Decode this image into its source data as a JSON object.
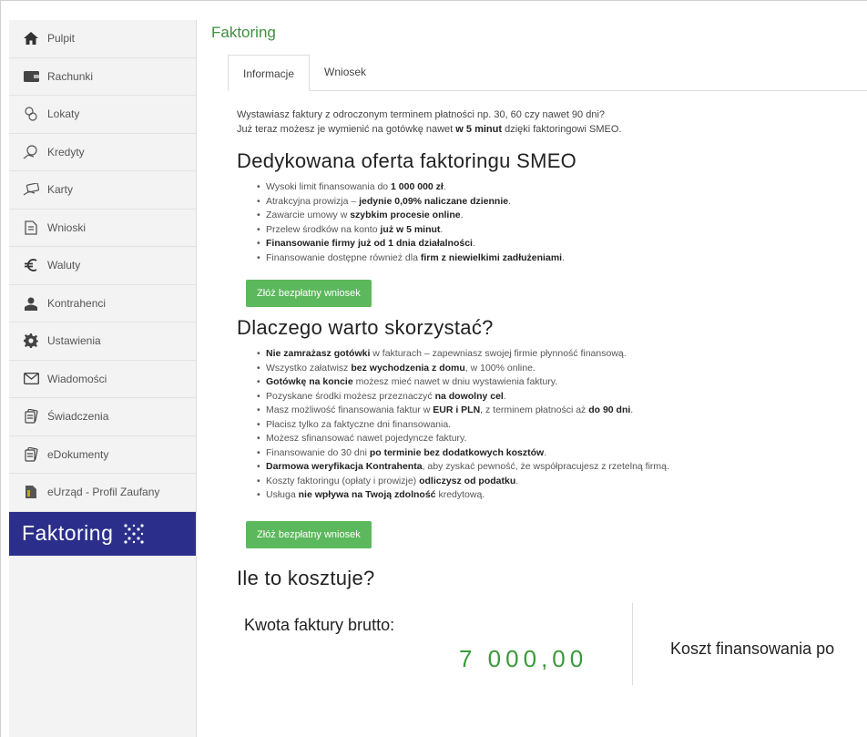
{
  "sidebar": {
    "items": [
      {
        "label": "Pulpit",
        "icon": "home-icon"
      },
      {
        "label": "Rachunki",
        "icon": "wallet-icon"
      },
      {
        "label": "Lokaty",
        "icon": "coins-icon"
      },
      {
        "label": "Kredyty",
        "icon": "loan-icon"
      },
      {
        "label": "Karty",
        "icon": "card-hand-icon"
      },
      {
        "label": "Wnioski",
        "icon": "document-icon"
      },
      {
        "label": "Waluty",
        "icon": "euro-icon"
      },
      {
        "label": "Kontrahenci",
        "icon": "contractor-icon"
      },
      {
        "label": "Ustawienia",
        "icon": "gear-icon"
      },
      {
        "label": "Wiadomości",
        "icon": "envelope-icon"
      },
      {
        "label": "Świadczenia",
        "icon": "document-stack-icon"
      },
      {
        "label": "eDokumenty",
        "icon": "document-stack-icon"
      },
      {
        "label": "eUrząd - Profil Zaufany",
        "icon": "profile-doc-icon"
      }
    ],
    "faktoring_label": "Faktoring",
    "active_color": "#2b2f8b"
  },
  "main": {
    "title": "Faktoring",
    "tabs": [
      {
        "label": "Informacje",
        "active": true
      },
      {
        "label": "Wniosek",
        "active": false
      }
    ],
    "intro": {
      "line1": "Wystawiasz faktury z odroczonym terminem płatności np. 30, 60 czy nawet 90 dni?",
      "line2_a": "Już teraz możesz je wymienić na gotówkę nawet ",
      "line2_b": "w 5 minut",
      "line2_c": " dzięki faktoringowi SMEO."
    },
    "section1": {
      "heading": "Dedykowana oferta faktoringu SMEO",
      "items": [
        [
          {
            "t": "Wysoki limit finansowania do "
          },
          {
            "t": "1 000 000 zł",
            "b": true
          },
          {
            "t": "."
          }
        ],
        [
          {
            "t": "Atrakcyjna prowizja – "
          },
          {
            "t": "jedynie 0,09% naliczane dziennie",
            "b": true
          },
          {
            "t": "."
          }
        ],
        [
          {
            "t": "Zawarcie umowy w "
          },
          {
            "t": "szybkim procesie online",
            "b": true
          },
          {
            "t": "."
          }
        ],
        [
          {
            "t": "Przelew środków na konto "
          },
          {
            "t": "już w 5 minut",
            "b": true
          },
          {
            "t": "."
          }
        ],
        [
          {
            "t": "Finansowanie firmy już od 1 dnia działalności",
            "b": true
          },
          {
            "t": "."
          }
        ],
        [
          {
            "t": "Finansowanie dostępne również dla "
          },
          {
            "t": "firm z niewielkimi zadłużeniami",
            "b": true
          },
          {
            "t": "."
          }
        ]
      ],
      "cta": "Złóż bezpłatny wniosek"
    },
    "section2": {
      "heading": "Dlaczego warto skorzystać?",
      "items": [
        [
          {
            "t": "Nie zamrażasz gotówki",
            "b": true
          },
          {
            "t": " w fakturach – zapewniasz swojej firmie płynność finansową."
          }
        ],
        [
          {
            "t": "Wszystko załatwisz "
          },
          {
            "t": "bez wychodzenia z domu",
            "b": true
          },
          {
            "t": ", w 100% online."
          }
        ],
        [
          {
            "t": "Gotówkę na koncie",
            "b": true
          },
          {
            "t": " możesz mieć nawet w dniu wystawienia faktury."
          }
        ],
        [
          {
            "t": "Pozyskane środki możesz przeznaczyć "
          },
          {
            "t": "na dowolny cel",
            "b": true
          },
          {
            "t": "."
          }
        ],
        [
          {
            "t": "Masz możliwość finansowania faktur w "
          },
          {
            "t": "EUR i PLN",
            "b": true
          },
          {
            "t": ", z terminem płatności aż "
          },
          {
            "t": "do 90 dni",
            "b": true
          },
          {
            "t": "."
          }
        ],
        [
          {
            "t": "Płacisz tylko za faktyczne dni finansowania."
          }
        ],
        [
          {
            "t": "Możesz sfinansować nawet pojedyncze faktury."
          }
        ],
        [
          {
            "t": "Finansowanie do 30 dni "
          },
          {
            "t": "po terminie bez dodatkowych kosztów",
            "b": true
          },
          {
            "t": "."
          }
        ],
        [
          {
            "t": "Darmowa weryfikacja Kontrahenta",
            "b": true
          },
          {
            "t": ", aby zyskać pewność, że współpracujesz z rzetelną firmą."
          }
        ],
        [
          {
            "t": "Koszty faktoringu (opłaty i prowizje) "
          },
          {
            "t": "odliczysz od podatku",
            "b": true
          },
          {
            "t": "."
          }
        ],
        [
          {
            "t": "Usługa "
          },
          {
            "t": "nie wpływa na Twoją zdolność",
            "b": true
          },
          {
            "t": " kredytową."
          }
        ]
      ],
      "cta": "Złóż bezpłatny wniosek"
    },
    "section3": {
      "heading": "Ile to kosztuje?",
      "kwota_label": "Kwota faktury brutto:",
      "amount": "7 000,00",
      "koszt_label": "Koszt finansowania po"
    }
  },
  "colors": {
    "accent_green": "#5cb85c",
    "title_green": "#3f8f3f",
    "amount_green": "#3a9b3a"
  }
}
